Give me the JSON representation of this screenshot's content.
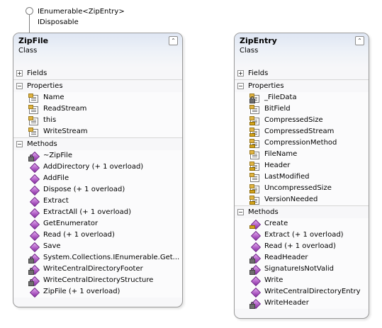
{
  "interfaces": [
    "IEnumerable<ZipEntry>",
    "IDisposable"
  ],
  "classes": {
    "zipfile": {
      "name": "ZipFile",
      "stereotype": "Class",
      "collapse_glyph": "⌃",
      "sections": {
        "fields": {
          "label": "Fields",
          "expander": "+"
        },
        "properties": {
          "label": "Properties",
          "expander": "−",
          "members": [
            "Name",
            "ReadStream",
            "this",
            "WriteStream"
          ]
        },
        "methods": {
          "label": "Methods",
          "expander": "−",
          "members": [
            "~ZipFile",
            "AddDirectory (+ 1 overload)",
            "AddFile",
            "Dispose (+ 1 overload)",
            "Extract",
            "ExtractAll (+ 1 overload)",
            "GetEnumerator",
            "Read (+ 1 overload)",
            "Save",
            "System.Collections.IEnumerable.Get...",
            "WriteCentralDirectoryFooter",
            "WriteCentralDirectoryStructure",
            "ZipFile (+ 1 overload)"
          ]
        }
      }
    },
    "zipentry": {
      "name": "ZipEntry",
      "stereotype": "Class",
      "collapse_glyph": "⌃",
      "sections": {
        "fields": {
          "label": "Fields",
          "expander": "+"
        },
        "properties": {
          "label": "Properties",
          "expander": "−",
          "members": [
            "_FileData",
            "BitField",
            "CompressedSize",
            "CompressedStream",
            "CompressionMethod",
            "FileName",
            "Header",
            "LastModified",
            "UncompressedSize",
            "VersionNeeded"
          ]
        },
        "methods": {
          "label": "Methods",
          "expander": "−",
          "members": [
            "Create",
            "Extract (+ 1 overload)",
            "Read (+ 1 overload)",
            "ReadHeader",
            "SignatureIsNotValid",
            "Write",
            "WriteCentralDirectoryEntry",
            "WriteHeader"
          ]
        }
      }
    }
  }
}
